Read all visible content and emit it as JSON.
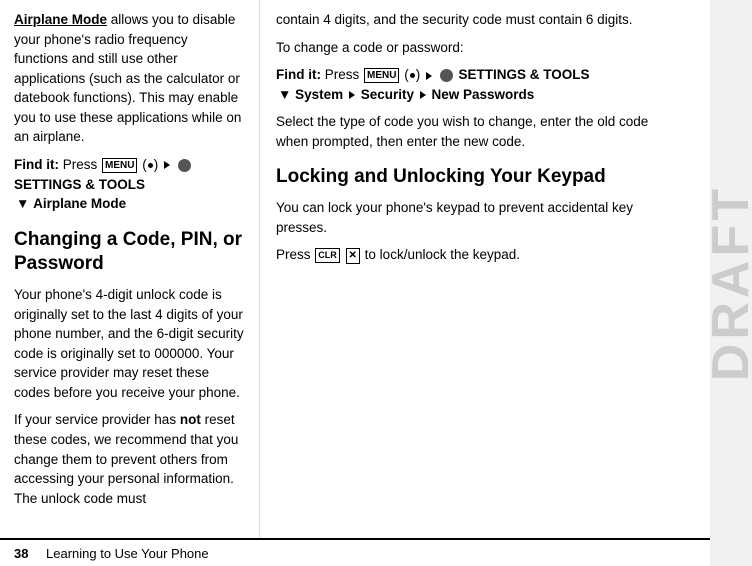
{
  "left": {
    "airplane_mode_bold": "Airplane Mode",
    "para1": " allows you to disable your phone's radio frequency functions and still use other applications (such as the calculator or datebook functions). This may enable you to use these applications while on an airplane.",
    "find_it_label": "Find it:",
    "find_it_press": " Press ",
    "menu_label": "MENU",
    "dot": "(●)",
    "arrow1": "▶",
    "settings_icon_label": "⚙",
    "settings_text": "SETTINGS & TOOLS",
    "arrow2": "▼",
    "airplane_mode_path": "Airplane Mode",
    "heading": "Changing a Code, PIN, or Password",
    "para2": "Your phone's 4-digit unlock code is originally set to the last 4 digits of your phone number, and the 6-digit security code is originally set to 000000. Your service provider may reset these codes before you receive your phone.",
    "para3_prefix": "If your service provider has ",
    "para3_not": "not",
    "para3_suffix": " reset these codes, we recommend that you change them to prevent others from accessing your personal information. The unlock code must"
  },
  "right": {
    "para_intro": "contain 4 digits, and the security code must contain 6 digits.",
    "para_change": "To change a code or password:",
    "find_it_label": "Find it:",
    "find_it_press": " Press ",
    "menu_label": "MENU",
    "settings_text": "SETTINGS & TOOLS",
    "arrow_down": "▼",
    "system": "System",
    "arrow2": "▶",
    "security": "Security",
    "arrow3": "▶",
    "new_passwords": "New Passwords",
    "para_select": "Select the type of code you wish to change, enter the old code when prompted, then enter the new code.",
    "heading2": "Locking and Unlocking Your Keypad",
    "para_lock": "You can lock your phone's keypad to prevent accidental key presses.",
    "press_label": "Press ",
    "clr_label": "CLR",
    "x_label": "✕",
    "lock_text": " to lock/unlock the keypad."
  },
  "bottom": {
    "page_number": "38",
    "label": "Learning to Use Your Phone"
  },
  "draft": "DRAFT"
}
